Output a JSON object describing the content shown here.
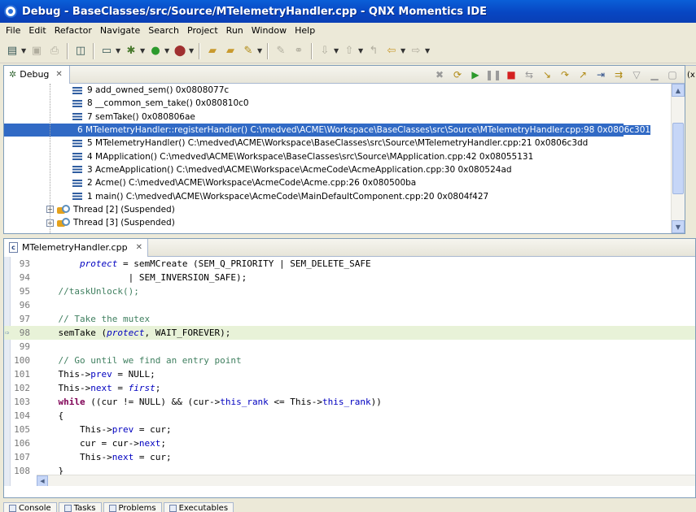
{
  "window": {
    "title": "Debug - BaseClasses/src/Source/MTelemetryHandler.cpp - QNX Momentics IDE"
  },
  "menu": [
    "File",
    "Edit",
    "Refactor",
    "Navigate",
    "Search",
    "Project",
    "Run",
    "Window",
    "Help"
  ],
  "debug_view": {
    "tab_label": "Debug",
    "tab_close": "✕",
    "frames": [
      {
        "label": "9 add_owned_sem()  0x0808077c",
        "selected": false
      },
      {
        "label": "8 __common_sem_take()  0x080810c0",
        "selected": false
      },
      {
        "label": "7 semTake()  0x080806ae",
        "selected": false
      },
      {
        "label": "6 MTelemetryHandler::registerHandler() C:\\medved\\ACME\\Workspace\\BaseClasses\\src\\Source\\MTelemetryHandler.cpp:98 0x0806c301",
        "selected": true
      },
      {
        "label": "5 MTelemetryHandler() C:\\medved\\ACME\\Workspace\\BaseClasses\\src\\Source\\MTelemetryHandler.cpp:21 0x0806c3dd",
        "selected": false
      },
      {
        "label": "4 MApplication() C:\\medved\\ACME\\Workspace\\BaseClasses\\src\\Source\\MApplication.cpp:42 0x08055131",
        "selected": false
      },
      {
        "label": "3 AcmeApplication() C:\\medved\\ACME\\Workspace\\AcmeCode\\AcmeApplication.cpp:30 0x080524ad",
        "selected": false
      },
      {
        "label": "2 Acme() C:\\medved\\ACME\\Workspace\\AcmeCode\\Acme.cpp:26 0x080500ba",
        "selected": false
      },
      {
        "label": "1 main() C:\\medved\\ACME\\Workspace\\AcmeCode\\MainDefaultComponent.cpp:20 0x0804f427",
        "selected": false
      }
    ],
    "threads": [
      {
        "label": "Thread [2] (Suspended)"
      },
      {
        "label": "Thread [3] (Suspended)"
      }
    ]
  },
  "side_panel": {
    "label": "(x"
  },
  "editor": {
    "tab_label": "MTelemetryHandler.cpp",
    "tab_close": "✕",
    "file_icon_letter": "c",
    "current_line": "98",
    "lines": [
      {
        "n": "93"
      },
      {
        "n": "94"
      },
      {
        "n": "95"
      },
      {
        "n": "96"
      },
      {
        "n": "97"
      },
      {
        "n": "98"
      },
      {
        "n": "99"
      },
      {
        "n": "100"
      },
      {
        "n": "101"
      },
      {
        "n": "102"
      },
      {
        "n": "103"
      },
      {
        "n": "104"
      },
      {
        "n": "105"
      },
      {
        "n": "106"
      },
      {
        "n": "107"
      },
      {
        "n": "108"
      }
    ],
    "code": {
      "l93_a": "        ",
      "l93_b": "protect",
      "l93_c": " = semMCreate (SEM_Q_PRIORITY | SEM_DELETE_SAFE",
      "l94": "                 | SEM_INVERSION_SAFE);",
      "l95": "    //taskUnlock();",
      "l96": "",
      "l97": "    // Take the mutex",
      "l98_a": "    semTake (",
      "l98_b": "protect",
      "l98_c": ", WAIT_FOREVER);",
      "l99": "",
      "l100": "    // Go until we find an entry point",
      "l101_a": "    This->",
      "l101_b": "prev",
      "l101_c": " = NULL;",
      "l102_a": "    This->",
      "l102_b": "next",
      "l102_c": " = ",
      "l102_d": "first",
      "l102_e": ";",
      "l103_a": "    ",
      "l103_kw": "while",
      "l103_b": " ((cur != NULL) && (cur->",
      "l103_c": "this_rank",
      "l103_d": " <= This->",
      "l103_e": "this_rank",
      "l103_f": "))",
      "l104": "    {",
      "l105_a": "        This->",
      "l105_b": "prev",
      "l105_c": " = cur;",
      "l106_a": "        cur = cur->",
      "l106_b": "next",
      "l106_c": ";",
      "l107_a": "        This->",
      "l107_b": "next",
      "l107_c": " = cur;",
      "l108": "    }"
    }
  },
  "bottom_tabs": [
    "Console",
    "Tasks",
    "Problems",
    "Executables"
  ],
  "colors": {
    "selection": "#316ac5",
    "keyword": "#7f0055",
    "comment": "#3f7f5f",
    "field": "#0000c0",
    "current_line": "#e8f2d8"
  }
}
